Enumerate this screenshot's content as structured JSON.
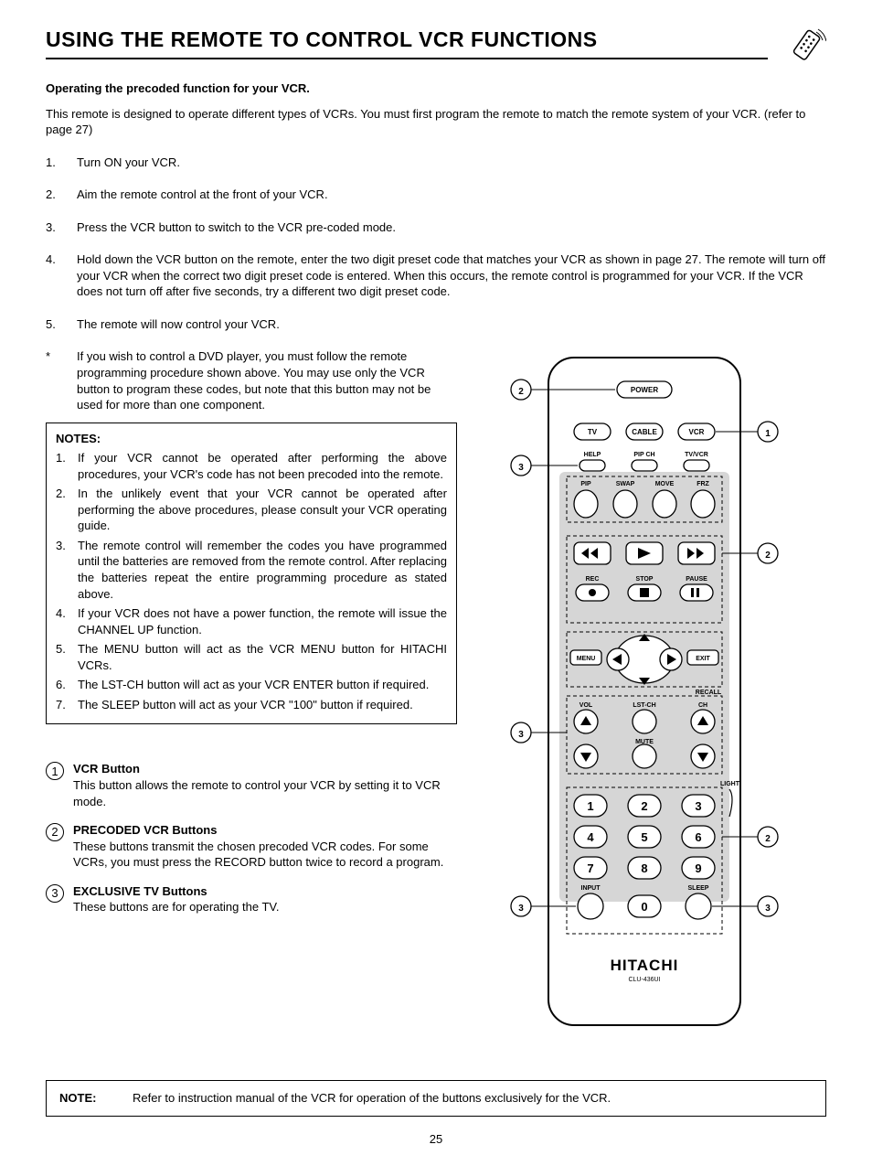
{
  "title": "USING THE REMOTE TO CONTROL VCR FUNCTIONS",
  "intro_bold": "Operating the precoded function for your VCR.",
  "intro_text": "This remote is designed to operate different types of VCRs.  You must first program the remote to match the remote system of your VCR. (refer to page 27)",
  "steps": [
    {
      "n": "1.",
      "t": "Turn ON your VCR."
    },
    {
      "n": "2.",
      "t": "Aim the remote control at the front of your VCR."
    },
    {
      "n": "3.",
      "t": "Press the VCR button to switch to the VCR pre-coded mode."
    },
    {
      "n": "4.",
      "t": "Hold down the VCR button on the remote, enter the two digit preset code that matches your VCR as shown in page 27.  The remote will turn off your VCR when the correct two digit preset code is entered.  When this occurs, the remote control is programmed for your VCR.  If the VCR does not turn off after five seconds, try a different two digit preset code."
    },
    {
      "n": "5.",
      "t": "The remote will now control your VCR."
    },
    {
      "n": "*",
      "t": "If you wish to control a DVD player, you must follow the remote programming procedure shown above.  You may use only the VCR button to program these codes, but note that this button may not be used for more than one component."
    }
  ],
  "notes_title": "NOTES:",
  "notes": [
    {
      "n": "1.",
      "t": "If your VCR cannot be operated after performing the above procedures, your VCR's code has not been precoded into the remote."
    },
    {
      "n": "2.",
      "t": "In the unlikely event that your VCR cannot be operated after performing the above procedures, please consult your VCR operating guide."
    },
    {
      "n": "3.",
      "t": "The remote control will remember the codes you have programmed until the batteries are removed from the remote control.  After replacing the batteries repeat the entire programming procedure as stated above."
    },
    {
      "n": "4.",
      "t": "If your VCR does not have a power function, the remote will issue the CHANNEL UP function."
    },
    {
      "n": "5.",
      "t": "The MENU button will act as the VCR MENU button for HITACHI VCRs."
    },
    {
      "n": "6.",
      "t": "The LST-CH button will act as your VCR ENTER button if required."
    },
    {
      "n": "7.",
      "t": "The SLEEP button will act as your VCR \"100\" button if required."
    }
  ],
  "callouts": [
    {
      "n": "1",
      "title": "VCR Button",
      "body": "This button allows the remote to control your VCR by  setting it to VCR mode."
    },
    {
      "n": "2",
      "title": "PRECODED VCR Buttons",
      "body": "These buttons transmit the chosen precoded VCR codes.  For some VCRs, you must press the RECORD button twice to record a program."
    },
    {
      "n": "3",
      "title": "EXCLUSIVE TV Buttons",
      "body": "These buttons are for operating the TV."
    }
  ],
  "note_bar_label": "NOTE:",
  "note_bar_text": "Refer to instruction manual of the VCR for operation of the buttons exclusively for the VCR.",
  "page_number": "25",
  "remote": {
    "power": "POWER",
    "tv": "TV",
    "cable": "CABLE",
    "vcr": "VCR",
    "help": "HELP",
    "pipch": "PIP CH",
    "tvvcr": "TV/VCR",
    "pip": "PIP",
    "swap": "SWAP",
    "move": "MOVE",
    "frz": "FRZ",
    "rec": "REC",
    "stop": "STOP",
    "pause": "PAUSE",
    "menu": "MENU",
    "exit": "EXIT",
    "recall": "RECALL",
    "vol": "VOL",
    "lstch": "LST-CH",
    "ch": "CH",
    "mute": "MUTE",
    "light": "LIGHT",
    "input": "INPUT",
    "sleep": "SLEEP",
    "brand": "HITACHI",
    "model": "CLU-436UI",
    "k1": "1",
    "k2": "2",
    "k3": "3",
    "k4": "4",
    "k5": "5",
    "k6": "6",
    "k7": "7",
    "k8": "8",
    "k9": "9",
    "k0": "0",
    "c1": "1",
    "c2": "2",
    "c3": "3"
  }
}
